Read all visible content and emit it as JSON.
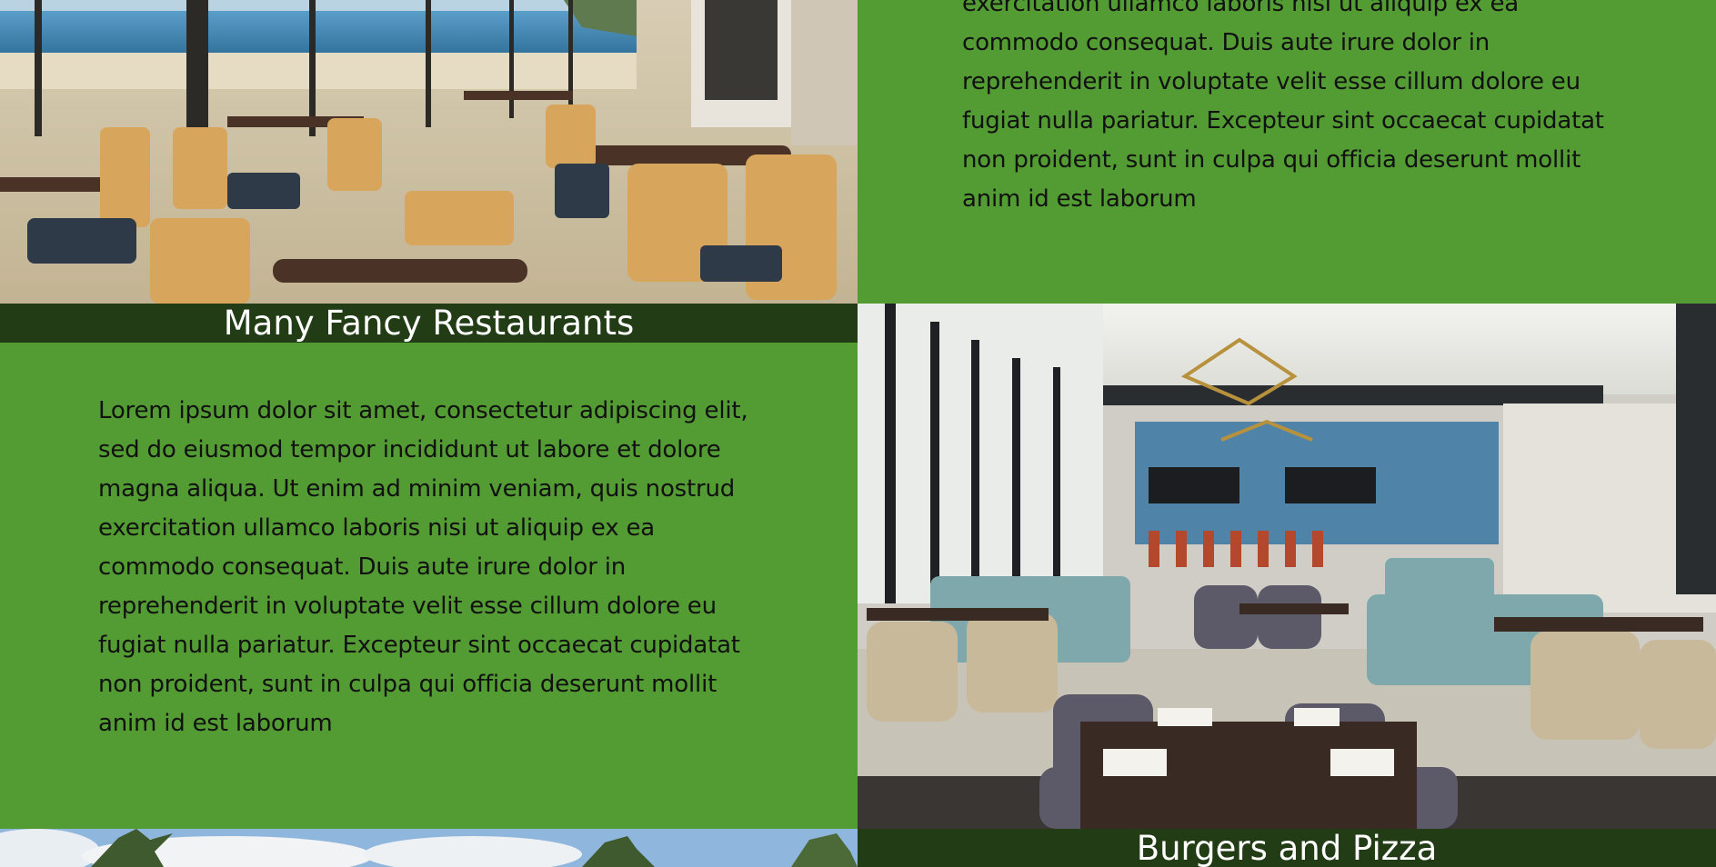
{
  "sections": [
    {
      "id": "top-right-text",
      "body": "exercitation ullamco laboris nisi ut aliquip ex ea commodo consequat. Duis aute irure dolor in reprehenderit in voluptate velit esse cillum dolore eu fugiat nulla pariatur. Excepteur sint occaecat cupidatat non proident, sunt in culpa qui officia deserunt mollit anim id est laborum"
    },
    {
      "id": "restaurants",
      "title": "Many Fancy Restaurants",
      "body": "Lorem ipsum dolor sit amet, consectetur adipiscing elit, sed do eiusmod tempor incididunt ut labore et dolore magna aliqua. Ut enim ad minim veniam, quis nostrud exercitation ullamco laboris nisi ut aliquip ex ea commodo consequat. Duis aute irure dolor in reprehenderit in voluptate velit esse cillum dolore eu fugiat nulla pariatur. Excepteur sint occaecat cupidatat non proident, sunt in culpa qui officia deserunt mollit anim id est laborum"
    },
    {
      "id": "burgers",
      "title": "Burgers and Pizza"
    }
  ],
  "colors": {
    "section_green": "#539b33",
    "caption_dark_green": "#223d15",
    "caption_text": "#ffffff",
    "body_text": "#111111"
  }
}
